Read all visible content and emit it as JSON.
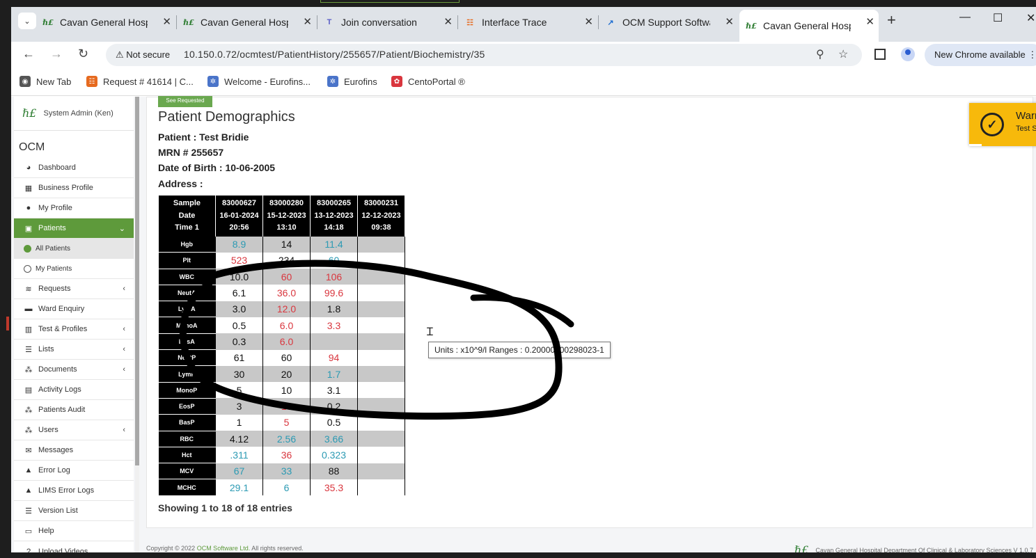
{
  "browser": {
    "tabs": [
      {
        "label": "Cavan General Hospi",
        "icon": "hse-icon",
        "active": false
      },
      {
        "label": "Cavan General Hospi",
        "icon": "hse-icon",
        "active": false
      },
      {
        "label": "Join conversation",
        "icon": "teams-icon",
        "active": false
      },
      {
        "label": "Interface Trace",
        "icon": "trace-icon",
        "active": false
      },
      {
        "label": "OCM Support Softwa",
        "icon": "ocm-icon",
        "active": false
      },
      {
        "label": "Cavan General Hospi",
        "icon": "hse-icon",
        "active": true
      }
    ],
    "new_tab": "+",
    "security": "Not secure",
    "url": "10.150.0.72/ocmtest/PatientHistory/255657/Patient/Biochemistry/35",
    "new_chrome": "New Chrome available",
    "bookmarks": [
      {
        "label": "New Tab",
        "icon": "globe-icon"
      },
      {
        "label": "Request # 41614 | C...",
        "icon": "request-icon"
      },
      {
        "label": "Welcome - Eurofins...",
        "icon": "eurofins-icon"
      },
      {
        "label": "Eurofins",
        "icon": "eurofins-icon"
      },
      {
        "label": "CentoPortal ®",
        "icon": "cento-icon"
      }
    ]
  },
  "sidebar": {
    "user": "System Admin (Ken)",
    "app": "OCM",
    "items": [
      {
        "label": "Dashboard",
        "icon": "dashboard-icon",
        "chevron": ""
      },
      {
        "label": "Business Profile",
        "icon": "building-icon",
        "chevron": ""
      },
      {
        "label": "My Profile",
        "icon": "user-icon",
        "chevron": ""
      },
      {
        "label": "Patients",
        "icon": "patients-icon",
        "chevron": "⌄",
        "active": true
      },
      {
        "label": "All Patients",
        "icon": "dot-filled",
        "chevron": "",
        "sub": true,
        "subactive": true
      },
      {
        "label": "My Patients",
        "icon": "dot-empty",
        "chevron": "",
        "sub": true
      },
      {
        "label": "Requests",
        "icon": "database-icon",
        "chevron": "‹"
      },
      {
        "label": "Ward Enquiry",
        "icon": "bed-icon",
        "chevron": ""
      },
      {
        "label": "Test & Profiles",
        "icon": "tests-icon",
        "chevron": "‹"
      },
      {
        "label": "Lists",
        "icon": "list-icon",
        "chevron": "‹"
      },
      {
        "label": "Documents",
        "icon": "users-icon",
        "chevron": "‹"
      },
      {
        "label": "Activity Logs",
        "icon": "logs-icon",
        "chevron": ""
      },
      {
        "label": "Patients Audit",
        "icon": "users-icon",
        "chevron": ""
      },
      {
        "label": "Users",
        "icon": "users-icon",
        "chevron": "‹"
      },
      {
        "label": "Messages",
        "icon": "envelope-icon",
        "chevron": ""
      },
      {
        "label": "Error Log",
        "icon": "warning-icon",
        "chevron": ""
      },
      {
        "label": "LIMS Error Logs",
        "icon": "warning-icon",
        "chevron": ""
      },
      {
        "label": "Version List",
        "icon": "list-icon",
        "chevron": ""
      },
      {
        "label": "Help",
        "icon": "keyboard-icon",
        "chevron": ""
      },
      {
        "label": "Upload Videos",
        "icon": "question-icon",
        "chevron": ""
      }
    ]
  },
  "main": {
    "see_requested": "See Requested",
    "title": "Patient Demographics",
    "patient": "Patient : Test Bridie",
    "mrn": "MRN # 255657",
    "dob": "Date of Birth : 10-06-2005",
    "address": "Address :",
    "table": {
      "headers": [
        [
          "Sample",
          "Date",
          "Time 1"
        ],
        [
          "83000627",
          "16-01-2024",
          "20:56"
        ],
        [
          "83000280",
          "15-12-2023",
          "13:10"
        ],
        [
          "83000265",
          "13-12-2023",
          "14:18"
        ],
        [
          "83000231",
          "12-12-2023",
          "09:38"
        ]
      ],
      "rows": [
        {
          "label": "Hgb",
          "cells": [
            [
              "8.9",
              "L"
            ],
            [
              "14",
              "N"
            ],
            [
              "11.4",
              "L"
            ],
            [
              "",
              ""
            ]
          ]
        },
        {
          "label": "Plt",
          "cells": [
            [
              "523",
              "H"
            ],
            [
              "234",
              "N"
            ],
            [
              "60",
              "L"
            ],
            [
              "",
              ""
            ]
          ]
        },
        {
          "label": "WBC",
          "cells": [
            [
              "10.0",
              "N"
            ],
            [
              "60",
              "H"
            ],
            [
              "106",
              "H"
            ],
            [
              "",
              ""
            ]
          ]
        },
        {
          "label": "NeutA",
          "cells": [
            [
              "6.1",
              "N"
            ],
            [
              "36.0",
              "H"
            ],
            [
              "99.6",
              "H"
            ],
            [
              "",
              ""
            ]
          ]
        },
        {
          "label": "LymA",
          "cells": [
            [
              "3.0",
              "N"
            ],
            [
              "12.0",
              "H"
            ],
            [
              "1.8",
              "N"
            ],
            [
              "",
              ""
            ]
          ]
        },
        {
          "label": "MonoA",
          "cells": [
            [
              "0.5",
              "N"
            ],
            [
              "6.0",
              "H"
            ],
            [
              "3.3",
              "H"
            ],
            [
              "",
              ""
            ]
          ]
        },
        {
          "label": "EosA",
          "cells": [
            [
              "0.3",
              "N"
            ],
            [
              "6.0",
              "H"
            ],
            [
              "",
              ""
            ],
            [
              "",
              ""
            ]
          ]
        },
        {
          "label": "NeutP",
          "cells": [
            [
              "61",
              "N"
            ],
            [
              "60",
              "N"
            ],
            [
              "94",
              "H"
            ],
            [
              "",
              ""
            ]
          ]
        },
        {
          "label": "LymP",
          "cells": [
            [
              "30",
              "N"
            ],
            [
              "20",
              "N"
            ],
            [
              "1.7",
              "L"
            ],
            [
              "",
              ""
            ]
          ]
        },
        {
          "label": "MonoP",
          "cells": [
            [
              "5",
              "N"
            ],
            [
              "10",
              "N"
            ],
            [
              "3.1",
              "N"
            ],
            [
              "",
              ""
            ]
          ]
        },
        {
          "label": "EosP",
          "cells": [
            [
              "3",
              "N"
            ],
            [
              "10",
              "H"
            ],
            [
              "0.2",
              "N"
            ],
            [
              "",
              ""
            ]
          ]
        },
        {
          "label": "BasP",
          "cells": [
            [
              "1",
              "N"
            ],
            [
              "5",
              "H"
            ],
            [
              "0.5",
              "N"
            ],
            [
              "",
              ""
            ]
          ]
        },
        {
          "label": "RBC",
          "cells": [
            [
              "4.12",
              "N"
            ],
            [
              "2.56",
              "L"
            ],
            [
              "3.66",
              "L"
            ],
            [
              "",
              ""
            ]
          ]
        },
        {
          "label": "Hct",
          "cells": [
            [
              ".311",
              "L"
            ],
            [
              "36",
              "H"
            ],
            [
              "0.323",
              "L"
            ],
            [
              "",
              ""
            ]
          ]
        },
        {
          "label": "MCV",
          "cells": [
            [
              "67",
              "L"
            ],
            [
              "33",
              "L"
            ],
            [
              "88",
              "N"
            ],
            [
              "",
              ""
            ]
          ]
        },
        {
          "label": "MCHC",
          "cells": [
            [
              "29.1",
              "L"
            ],
            [
              "6",
              "L"
            ],
            [
              "35.3",
              "H"
            ],
            [
              "",
              ""
            ]
          ]
        }
      ]
    },
    "tooltip": "Units : x10^9/l Ranges : 0.20000000298023-1",
    "showing": "Showing 1 to 18 of 18 entries"
  },
  "warning": {
    "title": "Warning",
    "subtitle": "Test System",
    "close": "×"
  },
  "footer": {
    "copyright_prefix": "Copyright © 2022 ",
    "company": "OCM Software Ltd.",
    "copyright_suffix": " All rights reserved.",
    "department": "Cavan General Hospital Department Of Clinical & Laboratory Sciences V 1.0.7"
  },
  "colors": {
    "accent": "#5e9a3b",
    "high": "#d9363e",
    "low": "#2b9ab3",
    "warning": "#f7b90b"
  }
}
